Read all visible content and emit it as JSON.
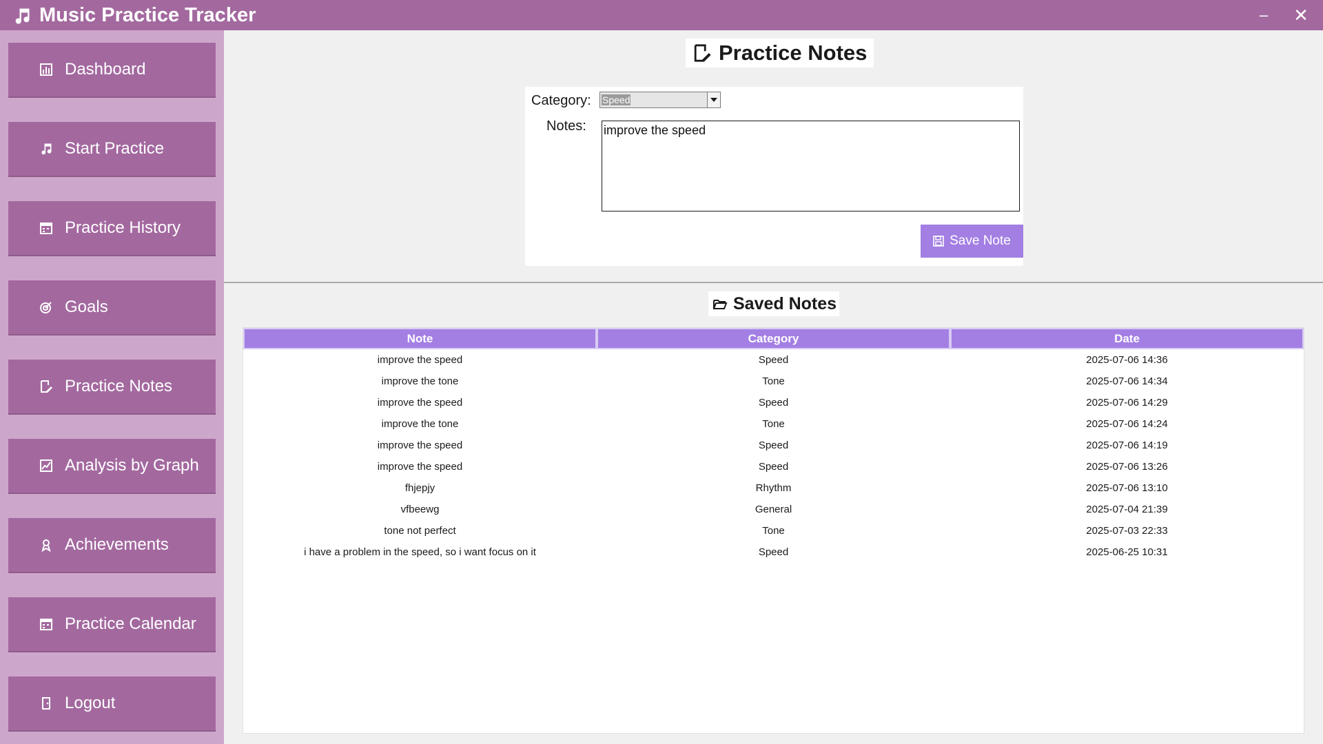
{
  "window": {
    "title": "Music Practice Tracker",
    "min_glyph": "–",
    "close_glyph": "✕"
  },
  "sidebar": {
    "items": [
      {
        "label": "Dashboard",
        "icon": "chart-icon"
      },
      {
        "label": "Start Practice",
        "icon": "music-note-icon"
      },
      {
        "label": "Practice History",
        "icon": "calendar-icon"
      },
      {
        "label": "Goals",
        "icon": "target-icon"
      },
      {
        "label": "Practice Notes",
        "icon": "edit-note-icon"
      },
      {
        "label": "Analysis by Graph",
        "icon": "graph-icon"
      },
      {
        "label": "Achievements",
        "icon": "trophy-icon"
      },
      {
        "label": "Practice Calendar",
        "icon": "calendar-icon"
      },
      {
        "label": "Logout",
        "icon": "door-icon"
      }
    ]
  },
  "notes_form": {
    "title": "Practice Notes",
    "category_label": "Category:",
    "category_value": "Speed",
    "notes_label": "Notes:",
    "notes_value": "improve the speed",
    "save_label": "Save Note"
  },
  "saved_notes": {
    "title": "Saved Notes",
    "columns": [
      "Note",
      "Category",
      "Date"
    ],
    "rows": [
      [
        "improve the speed",
        "Speed",
        "2025-07-06 14:36"
      ],
      [
        "improve the tone",
        "Tone",
        "2025-07-06 14:34"
      ],
      [
        "improve the speed",
        "Speed",
        "2025-07-06 14:29"
      ],
      [
        "improve the tone",
        "Tone",
        "2025-07-06 14:24"
      ],
      [
        "improve the speed",
        "Speed",
        "2025-07-06 14:19"
      ],
      [
        "improve the speed",
        "Speed",
        "2025-07-06 13:26"
      ],
      [
        "fhjepjy",
        "Rhythm",
        "2025-07-06 13:10"
      ],
      [
        "vfbeewg",
        "General",
        "2025-07-04 21:39"
      ],
      [
        "tone not perfect",
        "Tone",
        "2025-07-03 22:33"
      ],
      [
        "i have a problem in the speed, so i want focus on it",
        "Speed",
        "2025-06-25 10:31"
      ]
    ]
  },
  "colors": {
    "titlebar": "#a3699f",
    "sidebar": "#cda7cb",
    "nav_button": "#a3699f",
    "accent": "#a37fe3"
  }
}
